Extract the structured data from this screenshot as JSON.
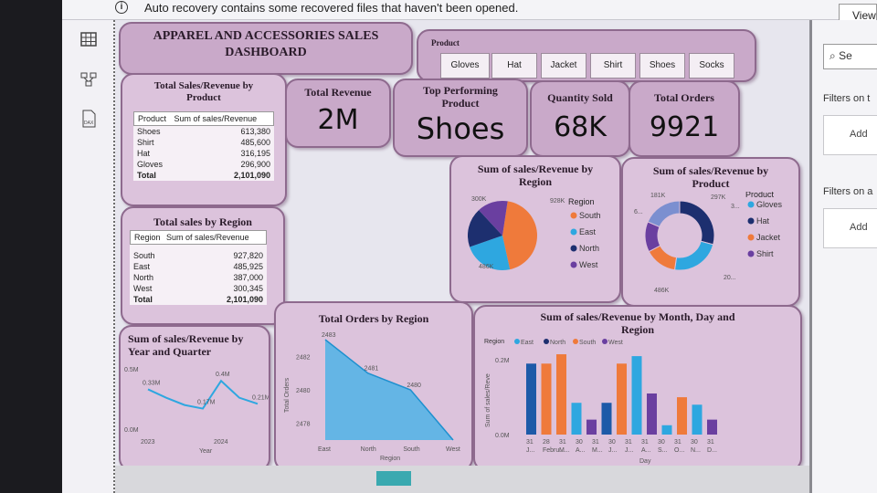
{
  "app": {
    "notification": "Auto recovery contains some recovered files that haven't been opened.",
    "view_label": "View"
  },
  "right_panel": {
    "search_placeholder": "Se",
    "filters_on_page": "Filters on t",
    "filters_on_all": "Filters on a",
    "add_1": "Add",
    "add_2": "Add"
  },
  "dashboard": {
    "title": "APPAREL AND ACCESSORIES SALES DASHBOARD",
    "product_slicer": {
      "label": "Product",
      "options": [
        "Gloves",
        "Hat",
        "Jacket",
        "Shirt",
        "Shoes",
        "Socks"
      ]
    },
    "kpis": {
      "total_revenue": {
        "label": "Total Revenue",
        "value": "2M"
      },
      "top_product": {
        "label": "Top Performing Product",
        "value": "Shoes"
      },
      "quantity_sold": {
        "label": "Quantity Sold",
        "value": "68K"
      },
      "total_orders": {
        "label": "Total Orders",
        "value": "9921"
      }
    },
    "product_table": {
      "title": "Total Sales/Revenue by Product",
      "headers": [
        "Product",
        "Sum of sales/Revenue"
      ],
      "rows": [
        [
          "Shoes",
          "613,380"
        ],
        [
          "Shirt",
          "485,600"
        ],
        [
          "Hat",
          "316,195"
        ],
        [
          "Gloves",
          "296,900"
        ]
      ],
      "total_label": "Total",
      "total_value": "2,101,090"
    },
    "region_table": {
      "title": "Total sales by Region",
      "headers": [
        "Region",
        "Sum of sales/Revenue"
      ],
      "rows": [
        [
          "South",
          "927,820"
        ],
        [
          "East",
          "485,925"
        ],
        [
          "North",
          "387,000"
        ],
        [
          "West",
          "300,345"
        ]
      ],
      "total_label": "Total",
      "total_value": "2,101,090"
    }
  },
  "colors": {
    "card": "#c9a9c9",
    "card_border": "#8e6a8e",
    "east": "#2ea7e0",
    "north": "#1d2f6f",
    "south": "#ef7a3b",
    "west": "#6a3fa0"
  },
  "chart_data": [
    {
      "type": "pie",
      "title": "Sum of sales/Revenue by Region",
      "legend_title": "Region",
      "categories": [
        "South",
        "East",
        "North",
        "West"
      ],
      "values": [
        927820,
        485925,
        387000,
        300345
      ],
      "data_labels": [
        "928K",
        "486K",
        "",
        "300K"
      ],
      "legend": "right"
    },
    {
      "type": "pie",
      "title": "Sum of sales/Revenue by Product",
      "legend_title": "Product",
      "categories": [
        "Shoes",
        "Shirt",
        "Hat",
        "Gloves",
        "Jacket"
      ],
      "values": [
        613380,
        485600,
        316195,
        296900,
        389015
      ],
      "data_labels": [
        "181K",
        "297K",
        "3...",
        "20...",
        "486K",
        "6..."
      ],
      "legend": [
        "Gloves",
        "Hat",
        "Jacket",
        "Shirt"
      ],
      "legend_colors": [
        "#2ea7e0",
        "#1d2f6f",
        "#ef7a3b",
        "#6a3fa0"
      ]
    },
    {
      "type": "line",
      "title": "Sum of sales/Revenue by Year and Quarter",
      "xlabel": "Year",
      "categories": [
        "2023",
        "",
        "",
        "",
        "2024",
        "",
        ""
      ],
      "values": [
        0.33,
        0.26,
        0.2,
        0.17,
        0.4,
        0.26,
        0.21
      ],
      "data_labels": [
        "0.33M",
        "",
        "0.17M",
        "0.4M",
        "0.21M"
      ],
      "yticks": [
        "0.5M",
        "0.0M"
      ],
      "ylim": [
        0,
        0.5
      ]
    },
    {
      "type": "area",
      "title": "Total Orders by Region",
      "xlabel": "Region",
      "ylabel": "Total Orders",
      "categories": [
        "East",
        "North",
        "South",
        "West"
      ],
      "values": [
        2483,
        2481,
        2480,
        2477
      ],
      "data_labels": [
        "2483",
        "2481",
        "2480",
        ""
      ],
      "yticks": [
        "2482",
        "2480",
        "2478"
      ],
      "ylim": [
        2477,
        2483
      ]
    },
    {
      "type": "bar",
      "title": "Sum of sales/Revenue by Month, Day and Region",
      "legend_title": "Region",
      "legend": [
        "East",
        "North",
        "South",
        "West"
      ],
      "xlabel": "Day",
      "ylabel": "Sum of sales/Reve",
      "yticks": [
        "0.2M",
        "0.0M"
      ],
      "categories": [
        "31",
        "28",
        "31",
        "30",
        "31",
        "30",
        "31",
        "31",
        "30",
        "31",
        "30",
        "31"
      ],
      "month_labels": [
        "J...",
        "Febru...",
        "M...",
        "A...",
        "M...",
        "J...",
        "J...",
        "A...",
        "S...",
        "O...",
        "N...",
        "D..."
      ],
      "values": [
        0.19,
        0.19,
        0.215,
        0.085,
        0.04,
        0.085,
        0.19,
        0.21,
        0.11,
        0.025,
        0.1,
        0.08,
        0.04
      ],
      "bar_colors": [
        "#1d5aa8",
        "#ef7a3b",
        "#ef7a3b",
        "#2ea7e0",
        "#6a3fa0",
        "#1d5aa8",
        "#ef7a3b",
        "#2ea7e0",
        "#6a3fa0",
        "#2ea7e0",
        "#ef7a3b",
        "#2ea7e0",
        "#6a3fa0"
      ]
    }
  ]
}
